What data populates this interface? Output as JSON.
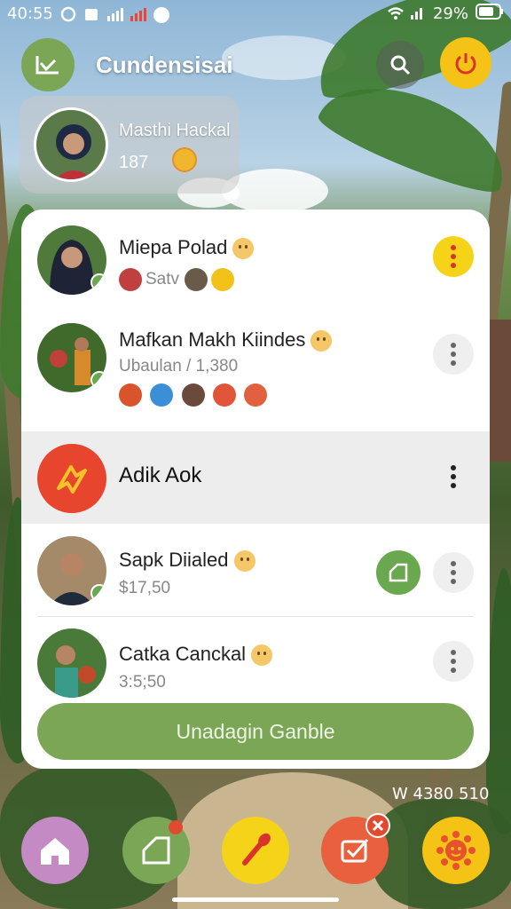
{
  "status_bar": {
    "time": "40:55",
    "battery": "29%"
  },
  "header": {
    "title": "Cundensisai"
  },
  "profile": {
    "name": "Masthi Hackal",
    "count": "187"
  },
  "list": [
    {
      "name": "Miepa Polad",
      "sub": "Satv",
      "menu_style": "yellow"
    },
    {
      "name": "Mafkan Makh Kiindes",
      "sub": "Ubaulan / 1,380",
      "menu_style": "grey"
    },
    {
      "name": "Adik Aok",
      "sub": "",
      "menu_style": "plain"
    },
    {
      "name": "Sapk Diialed",
      "sub": "$17,50",
      "menu_style": "grey"
    },
    {
      "name": "Catka Canckal",
      "sub": "3:5;50",
      "menu_style": "grey"
    }
  ],
  "cta_label": "Unadagin Ganble",
  "statline": "W 4380 510",
  "colors": {
    "accent_green": "#7aa656",
    "accent_yellow": "#f4c316",
    "accent_red": "#e04a2e",
    "nav_purple": "#c48ac4"
  }
}
